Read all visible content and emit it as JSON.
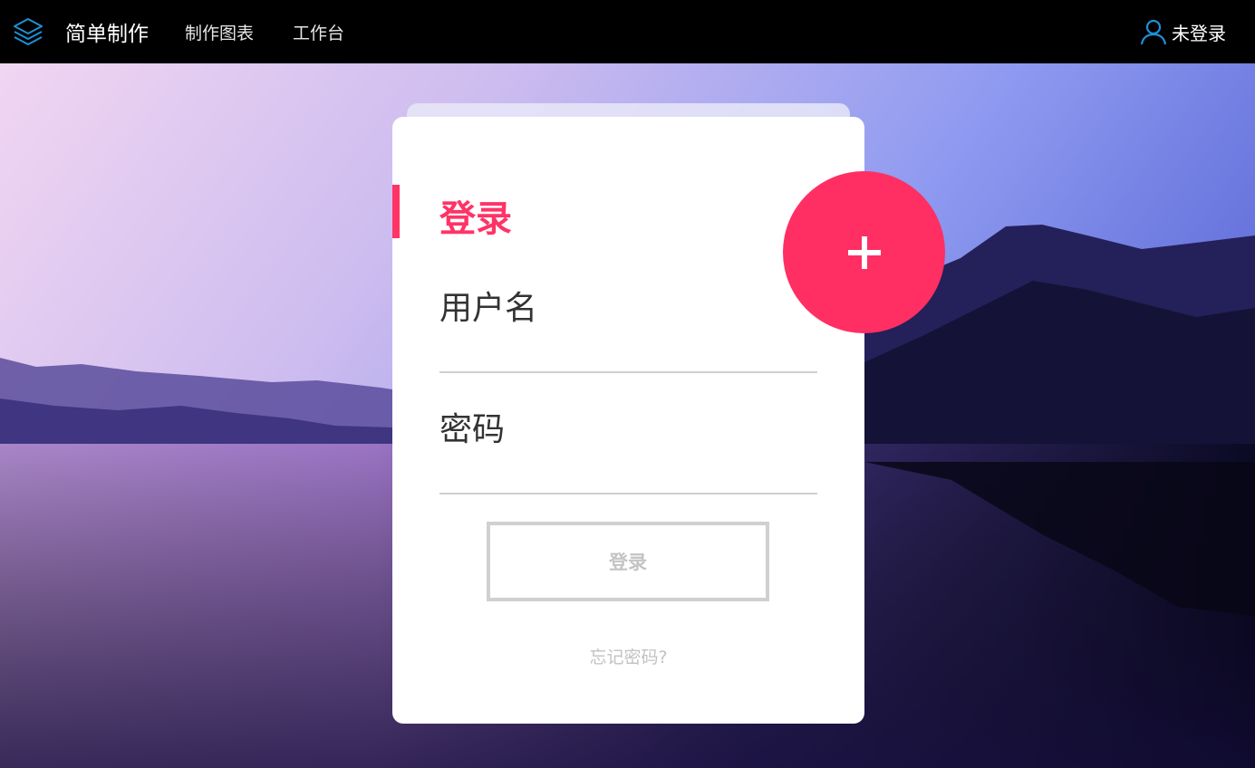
{
  "nav": {
    "brand": "简单制作",
    "links": [
      {
        "label": "制作图表"
      },
      {
        "label": "工作台"
      }
    ],
    "user_status": "未登录",
    "logo_icon": "layers-icon",
    "user_icon": "user-icon"
  },
  "login": {
    "title": "登录",
    "username_label": "用户名",
    "username_value": "",
    "password_label": "密码",
    "password_value": "",
    "submit_label": "登录",
    "forgot_label": "忘记密码?",
    "plus_icon": "plus-icon"
  },
  "colors": {
    "accent": "#ff3366",
    "navbar_bg": "#000000",
    "icon_blue": "#1e90d6"
  }
}
